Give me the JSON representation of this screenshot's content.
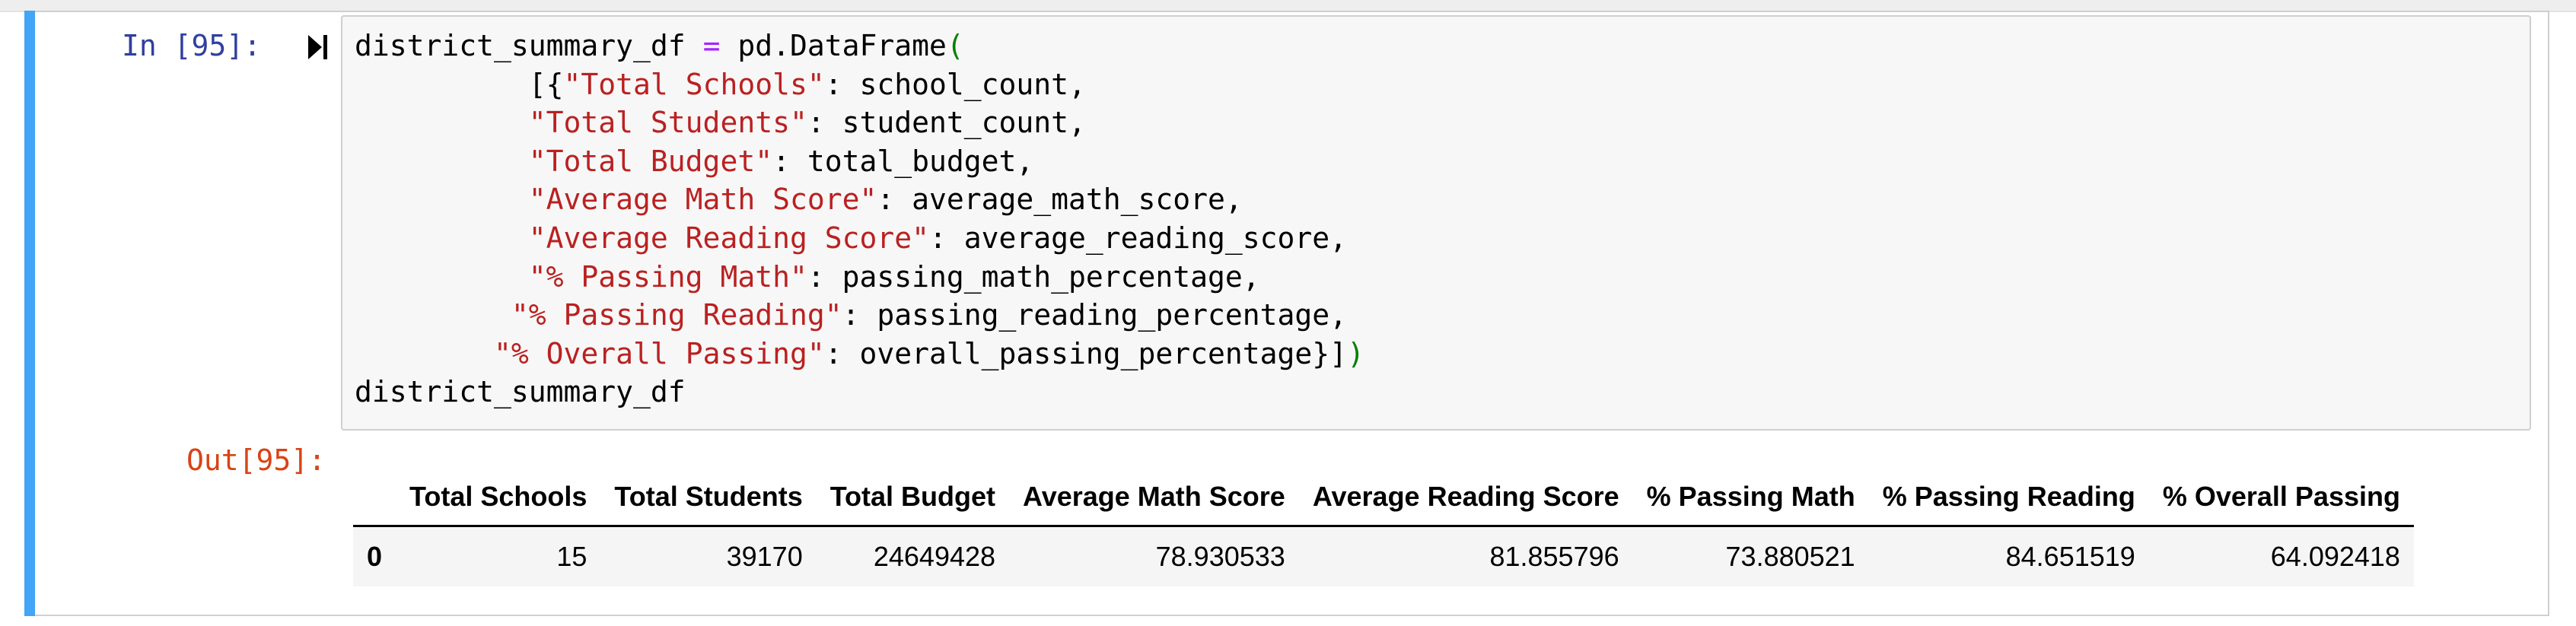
{
  "cell": {
    "input_prompt": "In [95]:",
    "output_prompt": "Out[95]:",
    "code_lines": [
      [
        {
          "t": "district_summary_df ",
          "c": ""
        },
        {
          "t": "=",
          "c": "op"
        },
        {
          "t": " pd.DataFrame",
          "c": ""
        },
        {
          "t": "(",
          "c": "par"
        }
      ],
      [
        {
          "t": "          [{",
          "c": ""
        },
        {
          "t": "\"Total Schools\"",
          "c": "str"
        },
        {
          "t": ": school_count,",
          "c": ""
        }
      ],
      [
        {
          "t": "          ",
          "c": ""
        },
        {
          "t": "\"Total Students\"",
          "c": "str"
        },
        {
          "t": ": student_count,",
          "c": ""
        }
      ],
      [
        {
          "t": "          ",
          "c": ""
        },
        {
          "t": "\"Total Budget\"",
          "c": "str"
        },
        {
          "t": ": total_budget,",
          "c": ""
        }
      ],
      [
        {
          "t": "          ",
          "c": ""
        },
        {
          "t": "\"Average Math Score\"",
          "c": "str"
        },
        {
          "t": ": average_math_score,",
          "c": ""
        }
      ],
      [
        {
          "t": "          ",
          "c": ""
        },
        {
          "t": "\"Average Reading Score\"",
          "c": "str"
        },
        {
          "t": ": average_reading_score,",
          "c": ""
        }
      ],
      [
        {
          "t": "          ",
          "c": ""
        },
        {
          "t": "\"% Passing Math\"",
          "c": "str"
        },
        {
          "t": ": passing_math_percentage,",
          "c": ""
        }
      ],
      [
        {
          "t": "         ",
          "c": ""
        },
        {
          "t": "\"% Passing Reading\"",
          "c": "str"
        },
        {
          "t": ": passing_reading_percentage,",
          "c": ""
        }
      ],
      [
        {
          "t": "        ",
          "c": ""
        },
        {
          "t": "\"% Overall Passing\"",
          "c": "str"
        },
        {
          "t": ": overall_passing_percentage}]",
          "c": ""
        },
        {
          "t": ")",
          "c": "par"
        }
      ],
      [
        {
          "t": "district_summary_df",
          "c": ""
        }
      ]
    ]
  },
  "dataframe": {
    "columns": [
      "",
      "Total Schools",
      "Total Students",
      "Total Budget",
      "Average Math Score",
      "Average Reading Score",
      "% Passing Math",
      "% Passing Reading",
      "% Overall Passing"
    ],
    "rows": [
      {
        "index": "0",
        "values": [
          "15",
          "39170",
          "24649428",
          "78.930533",
          "81.855796",
          "73.880521",
          "84.651519",
          "64.092418"
        ]
      }
    ]
  },
  "colors": {
    "cell_bar": "#42a5f5",
    "input_prompt": "#303f9f",
    "output_prompt": "#d84315",
    "string": "#ba2121",
    "operator": "#aa22ff",
    "paren": "#008000"
  },
  "icons": {
    "collapse": "collapse-triangle-icon"
  }
}
